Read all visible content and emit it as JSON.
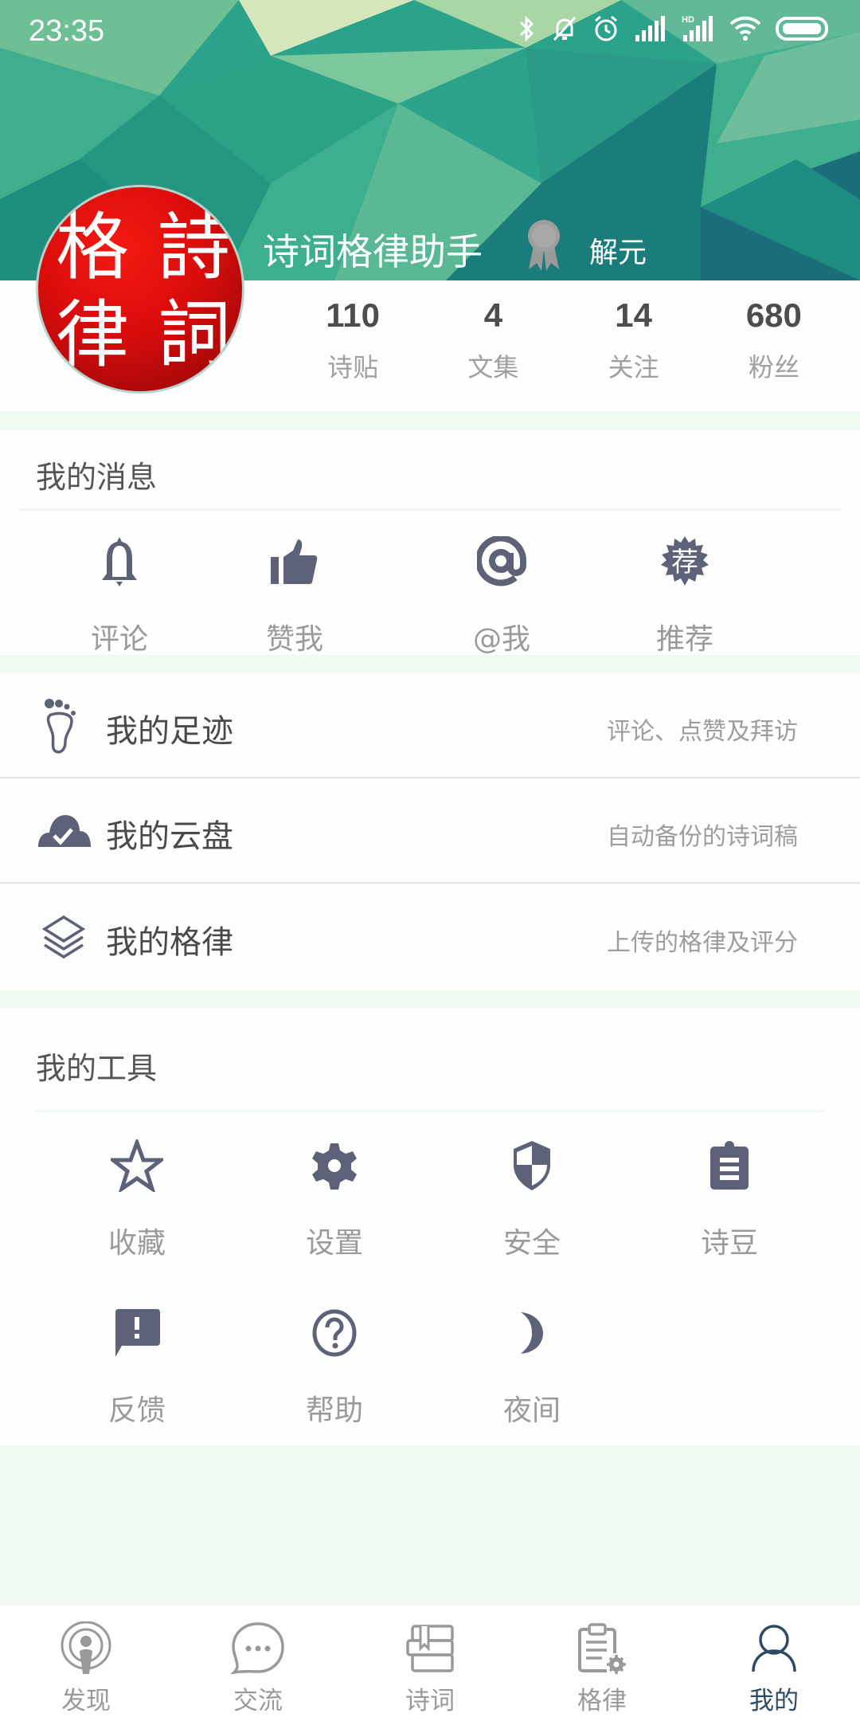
{
  "status_bar": {
    "time": "23:35",
    "icons": [
      "bluetooth-icon",
      "mute-icon",
      "alarm-icon",
      "signal-icon",
      "hd-signal-icon",
      "wifi-icon",
      "battery-icon"
    ],
    "hd_label": "HD"
  },
  "profile": {
    "avatar_chars": [
      "詩",
      "格",
      "詞",
      "律"
    ],
    "username": "诗词格律助手",
    "badge_icon": "ribbon-award-icon",
    "rank": "解元",
    "stats": [
      {
        "value": "110",
        "label": "诗贴"
      },
      {
        "value": "4",
        "label": "文集"
      },
      {
        "value": "14",
        "label": "关注"
      },
      {
        "value": "680",
        "label": "粉丝"
      }
    ]
  },
  "messages": {
    "title": "我的消息",
    "items": [
      {
        "icon": "bell-icon",
        "label": "评论"
      },
      {
        "icon": "thumbs-up-icon",
        "label": "赞我"
      },
      {
        "icon": "at-icon",
        "label": "@我"
      },
      {
        "icon": "recommend-badge-icon",
        "label": "推荐",
        "glyph": "荐"
      }
    ]
  },
  "list": [
    {
      "icon": "footprint-icon",
      "title": "我的足迹",
      "desc": "评论、点赞及拜访"
    },
    {
      "icon": "cloud-check-icon",
      "title": "我的云盘",
      "desc": "自动备份的诗词稿"
    },
    {
      "icon": "layers-icon",
      "title": "我的格律",
      "desc": "上传的格律及评分"
    }
  ],
  "tools": {
    "title": "我的工具",
    "items": [
      {
        "icon": "star-icon",
        "label": "收藏"
      },
      {
        "icon": "gear-icon",
        "label": "设置"
      },
      {
        "icon": "shield-icon",
        "label": "安全"
      },
      {
        "icon": "clipboard-icon",
        "label": "诗豆"
      },
      {
        "icon": "feedback-icon",
        "label": "反馈"
      },
      {
        "icon": "help-icon",
        "label": "帮助"
      },
      {
        "icon": "moon-icon",
        "label": "夜间"
      }
    ]
  },
  "nav": [
    {
      "icon": "podcast-icon",
      "label": "发现",
      "active": false
    },
    {
      "icon": "chat-bubble-icon",
      "label": "交流",
      "active": false
    },
    {
      "icon": "books-icon",
      "label": "诗词",
      "active": false
    },
    {
      "icon": "clipboard-gear-icon",
      "label": "格律",
      "active": false
    },
    {
      "icon": "user-icon",
      "label": "我的",
      "active": true
    }
  ],
  "colors": {
    "icon": "#5e6278",
    "nav_active": "#2f4a63",
    "nav_inactive": "#999999",
    "background": "#f1f9f3"
  }
}
